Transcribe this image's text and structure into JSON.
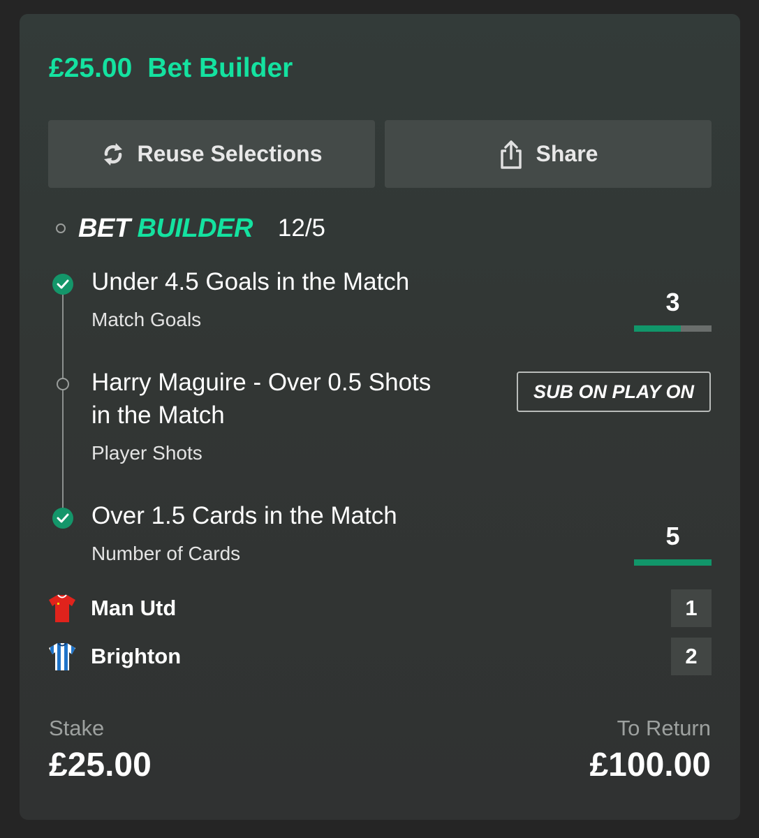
{
  "header": {
    "amount": "£25.00",
    "title": "Bet Builder"
  },
  "actions": {
    "reuse_label": "Reuse Selections",
    "share_label": "Share"
  },
  "bet_builder": {
    "logo_white": "BET",
    "logo_green": "BUILDER",
    "odds": "12/5"
  },
  "selections": [
    {
      "title": "Under 4.5 Goals in the Match",
      "market": "Match Goals",
      "status": "won",
      "count": "3",
      "progress": 0.6
    },
    {
      "title_line1": "Harry Maguire - Over 0.5 Shots",
      "title_line2": "in the Match",
      "market": "Player Shots",
      "status": "pending",
      "badge": "SUB ON PLAY ON"
    },
    {
      "title": "Over 1.5 Cards in the Match",
      "market": "Number of Cards",
      "status": "won",
      "count": "5",
      "progress": 1.0
    }
  ],
  "teams": [
    {
      "name": "Man Utd",
      "score": "1",
      "icon": "red-shirt-icon"
    },
    {
      "name": "Brighton",
      "score": "2",
      "icon": "blue-white-striped-shirt-icon"
    }
  ],
  "footer": {
    "stake_label": "Stake",
    "stake_value": "£25.00",
    "return_label": "To Return",
    "return_value": "£100.00"
  },
  "colors": {
    "accent": "#14e2a0",
    "progress": "#11966a",
    "card_bg": "#323634",
    "page_bg": "#252525"
  }
}
